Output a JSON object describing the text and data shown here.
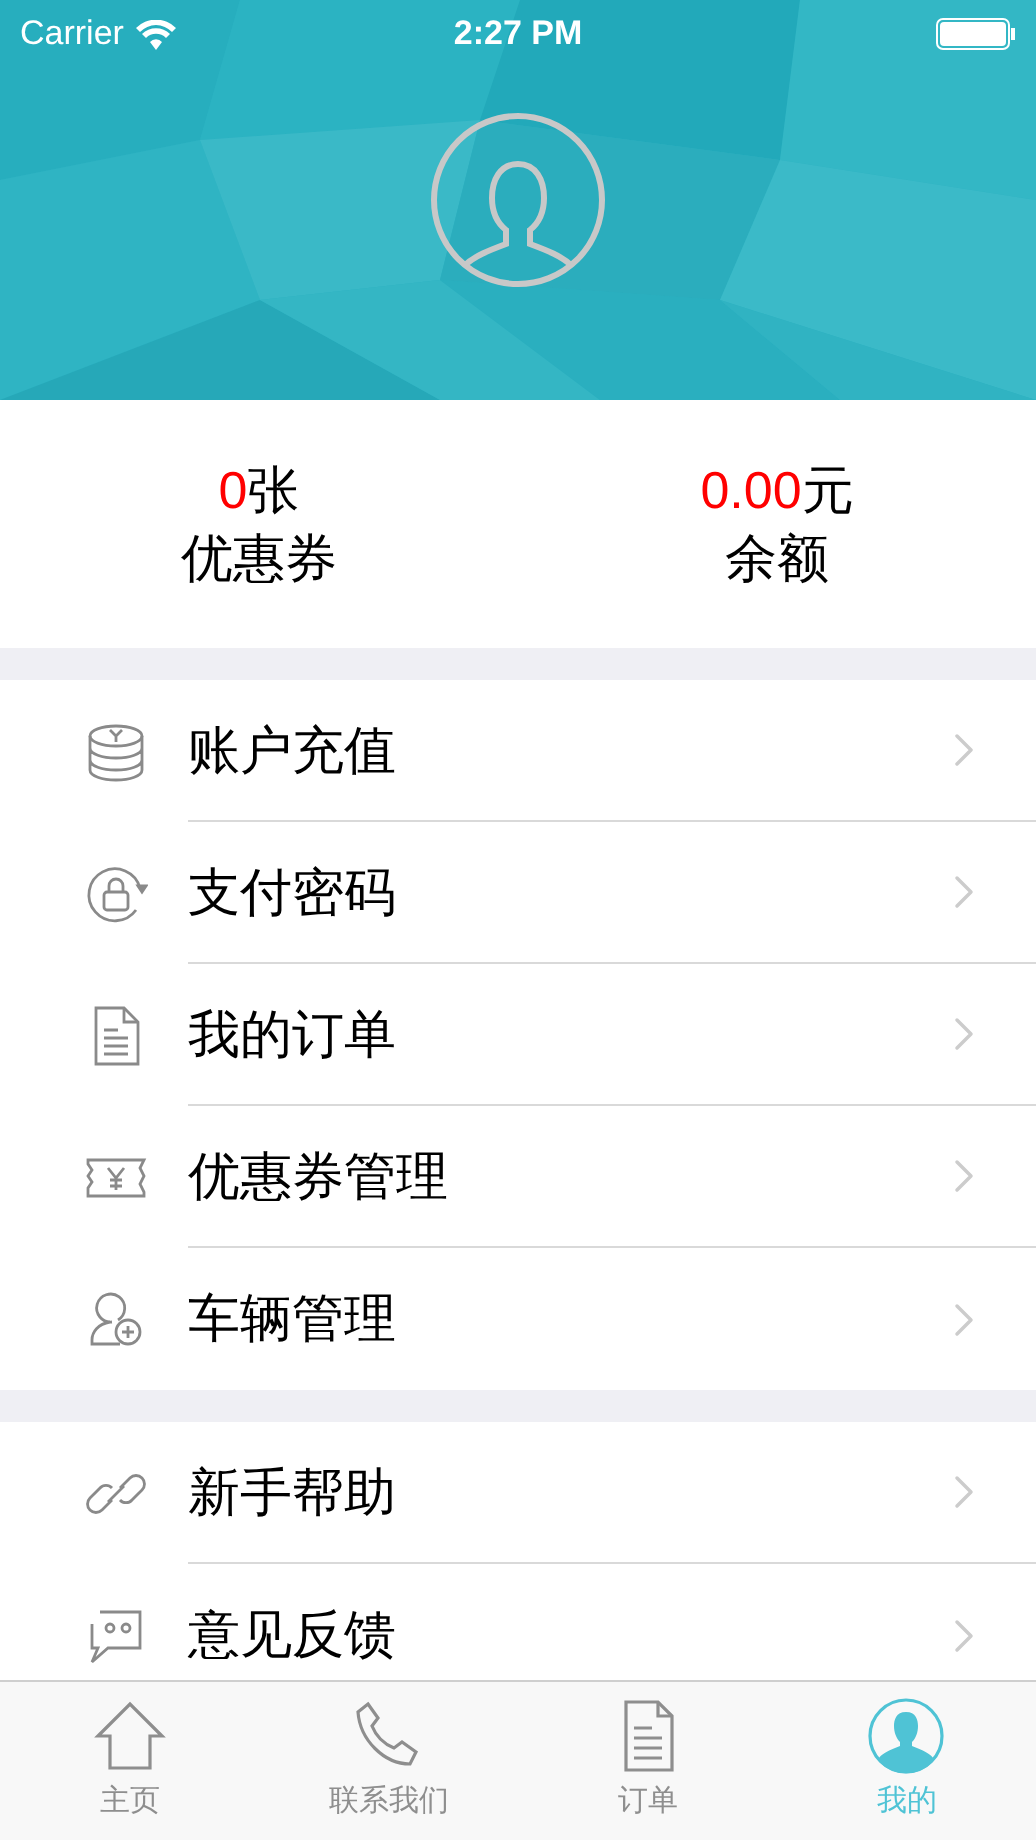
{
  "status_bar": {
    "carrier": "Carrier",
    "time": "2:27 PM"
  },
  "stats": [
    {
      "value": "0",
      "unit": "张",
      "label": "优惠券"
    },
    {
      "value": "0.00",
      "unit": "元",
      "label": "余额"
    }
  ],
  "menu_groups": [
    [
      {
        "kind": "coins",
        "label": "账户充值"
      },
      {
        "kind": "lock",
        "label": "支付密码"
      },
      {
        "kind": "document",
        "label": "我的订单"
      },
      {
        "kind": "ticket",
        "label": "优惠券管理"
      },
      {
        "kind": "person-add",
        "label": "车辆管理"
      }
    ],
    [
      {
        "kind": "link",
        "label": "新手帮助"
      },
      {
        "kind": "chat",
        "label": "意见反馈"
      }
    ]
  ],
  "tab_bar": [
    {
      "kind": "home",
      "label": "主页",
      "selected": false
    },
    {
      "kind": "phone",
      "label": "联系我们",
      "selected": false
    },
    {
      "kind": "document",
      "label": "订单",
      "selected": false
    },
    {
      "kind": "avatar",
      "label": "我的",
      "selected": true
    }
  ]
}
